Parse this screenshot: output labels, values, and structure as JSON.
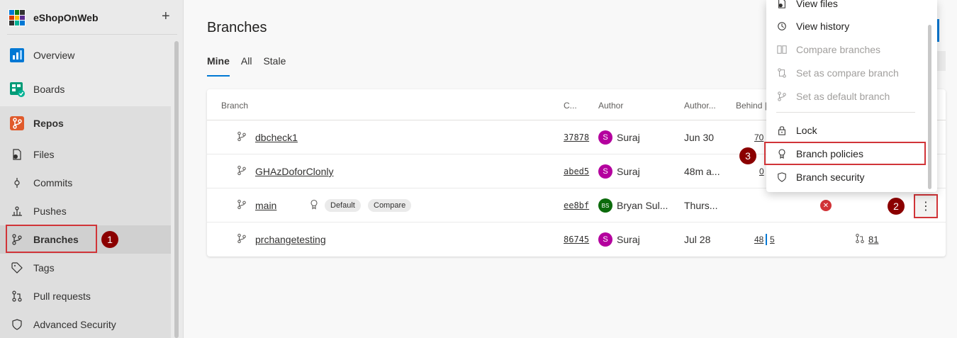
{
  "project": {
    "name": "eShopOnWeb",
    "add_symbol": "+"
  },
  "nav": {
    "overview": "Overview",
    "boards": "Boards",
    "repos": "Repos",
    "files": "Files",
    "commits": "Commits",
    "pushes": "Pushes",
    "branches": "Branches",
    "tags": "Tags",
    "pull_requests": "Pull requests",
    "advanced_security": "Advanced Security"
  },
  "page": {
    "title": "Branches",
    "tabs": [
      "Mine",
      "All",
      "Stale"
    ]
  },
  "table": {
    "headers": {
      "branch": "Branch",
      "commit": "C...",
      "author": "Author",
      "authored": "Author...",
      "behind": "Behind |"
    },
    "rows": [
      {
        "name": "dbcheck1",
        "commit": "37878",
        "avatar": "S",
        "author": "Suraj",
        "date": "Jun 30",
        "behind": "70",
        "ahead": "",
        "tag_default": "",
        "tag_compare": "",
        "pr": ""
      },
      {
        "name": "GHAzDoforClonly",
        "commit": "abed5",
        "avatar": "S",
        "author": "Suraj",
        "date": "48m a...",
        "behind": "0",
        "ahead": "",
        "tag_default": "",
        "tag_compare": "",
        "pr": ""
      },
      {
        "name": "main",
        "commit": "ee8bf",
        "avatar": "BS",
        "author": "Bryan Sul...",
        "date": "Thurs...",
        "behind": "",
        "ahead": "",
        "tag_default": "Default",
        "tag_compare": "Compare",
        "pr": ""
      },
      {
        "name": "prchangetesting",
        "commit": "86745",
        "avatar": "S",
        "author": "Suraj",
        "date": "Jul 28",
        "behind": "48",
        "ahead": "5",
        "tag_default": "",
        "tag_compare": "",
        "pr": "81"
      }
    ],
    "main_status_icon": "error-x-icon",
    "main_status_symbol": "✕"
  },
  "menu": {
    "items": [
      {
        "label": "View files",
        "icon": "view-files-icon",
        "disabled": false
      },
      {
        "label": "View history",
        "icon": "history-icon",
        "disabled": false
      },
      {
        "label": "Compare branches",
        "icon": "compare-icon",
        "disabled": true
      },
      {
        "label": "Set as compare branch",
        "icon": "set-compare-icon",
        "disabled": true
      },
      {
        "label": "Set as default branch",
        "icon": "branch-icon",
        "disabled": true
      },
      {
        "label": "Lock",
        "icon": "lock-icon",
        "disabled": false
      },
      {
        "label": "Branch policies",
        "icon": "policy-icon",
        "disabled": false
      },
      {
        "label": "Branch security",
        "icon": "shield-icon",
        "disabled": false
      }
    ]
  },
  "more_button": {
    "symbol": "⋮"
  },
  "steps": [
    "1",
    "2",
    "3"
  ],
  "colors": {
    "accent": "#0078d4",
    "annotation_red": "#d13438",
    "step_badge": "#8b0000",
    "avatar_suraj": "#b4009e",
    "avatar_bryan": "#0b6a0b"
  }
}
